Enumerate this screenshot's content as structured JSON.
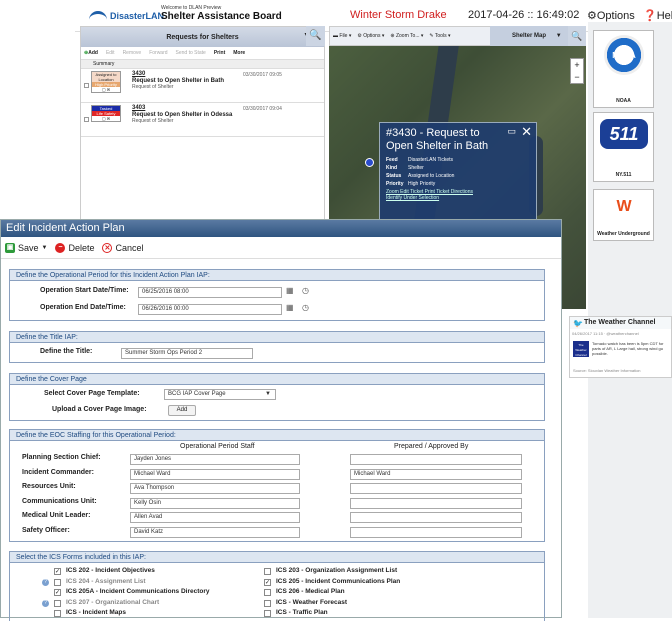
{
  "header": {
    "logo_text": "DisasterLAN",
    "welcome": "Welcome to DLAN Preview",
    "board_title": "Shelter Assistance Board",
    "event_name": "Winter Storm Drake",
    "clock": "2017-04-26 :: 16:49:02",
    "options_label": "Options",
    "help_label": "Help"
  },
  "requests": {
    "title": "Requests for Shelters",
    "tools": {
      "add": "Add",
      "edit": "Edit",
      "remove": "Remove",
      "forward": "Forward",
      "send_to_state": "Send to State",
      "print": "Print",
      "more": "More"
    },
    "summary_header": "Summary",
    "rows": [
      {
        "badge_status": "Assigned to Location",
        "badge_priority": "High Priority",
        "number": "3430",
        "title": "Request to Open Shelter in Bath",
        "subtitle": "Request of Shelter",
        "date": "03/30/2017 09:05"
      },
      {
        "badge_status": "Tasked",
        "badge_priority": "Life Safety",
        "number": "3403",
        "title": "Request to Open Shelter in Odessa",
        "subtitle": "Request of Shelter",
        "date": "03/30/2017 09:04"
      }
    ]
  },
  "map": {
    "toolbar": {
      "file": "File",
      "options": "Options",
      "zoom_to": "Zoom To...",
      "tools": "Tools"
    },
    "title": "Shelter Map",
    "popup": {
      "title": "#3430 - Request to Open Shelter in Bath",
      "feed_label": "Feed",
      "feed": "DisasterLAN Tickets",
      "kind_label": "Kind",
      "kind": "Shelter",
      "status_label": "Status",
      "status": "Assigned to Location",
      "priority_label": "Priority",
      "priority": "High Priority",
      "links": "Zoom  Edit Ticket  Print Ticket  Directions",
      "links2": "Identify Under Selection"
    }
  },
  "sidebar": {
    "noaa_label": "NOAA",
    "ny511_label": "NY.511",
    "wu_label": "Weather Underground",
    "twc": {
      "title": "The Weather Channel",
      "date": "04/26/2017 11:15 · @weatherchannel",
      "logo_text": "The Weather Channel",
      "text": "Tornado watch has been is 5pm CDT for parts of AR, L Large hail, strong wind gu possible.",
      "source": "Source: Siouxlan Weather Information"
    }
  },
  "iap": {
    "title": "Edit Incident Action Plan",
    "save": "Save",
    "delete": "Delete",
    "cancel": "Cancel",
    "period": {
      "header": "Define the Operational Period for this Incident Action Plan IAP:",
      "start_label": "Operation Start Date/Time:",
      "start_value": "06/25/2016 08:00",
      "end_label": "Operation End Date/Time:",
      "end_value": "06/26/2016 00:00"
    },
    "title_section": {
      "header": "Define the Title IAP:",
      "label": "Define the Title:",
      "value": "Summer Storm Ops Period 2"
    },
    "cover": {
      "header": "Define the Cover Page",
      "template_label": "Select Cover Page Template:",
      "template_value": "BCG IAP Cover Page",
      "upload_label": "Upload a Cover Page Image:",
      "add_button": "Add"
    },
    "staffing": {
      "header": "Define the EOC Staffing for this Operational Period:",
      "col_staff": "Operational Period Staff",
      "col_prepared": "Prepared / Approved By",
      "rows": [
        {
          "role": "Planning Section Chief:",
          "staff": "Jayden Jones",
          "prepared": ""
        },
        {
          "role": "Incident Commander:",
          "staff": "Michael Ward",
          "prepared": "Michael Ward"
        },
        {
          "role": "Resources Unit:",
          "staff": "Ava Thompson",
          "prepared": ""
        },
        {
          "role": "Communications Unit:",
          "staff": "Kelly Osin",
          "prepared": ""
        },
        {
          "role": "Medical Unit Leader:",
          "staff": "Allen Avad",
          "prepared": ""
        },
        {
          "role": "Safety Officer:",
          "staff": "David Katz",
          "prepared": ""
        }
      ]
    },
    "forms": {
      "header": "Select the ICS Forms included in this IAP:",
      "left": [
        {
          "label": "ICS 202 - Incident Objectives",
          "checked": true,
          "help": false,
          "disabled": false
        },
        {
          "label": "ICS 204 - Assignment List",
          "checked": false,
          "help": true,
          "disabled": true
        },
        {
          "label": "ICS 205A - Incident Communications Directory",
          "checked": true,
          "help": false,
          "disabled": false
        },
        {
          "label": "ICS 207 - Organizational Chart",
          "checked": false,
          "help": true,
          "disabled": true
        },
        {
          "label": "ICS - Incident Maps",
          "checked": false,
          "help": false,
          "disabled": false
        }
      ],
      "right": [
        {
          "label": "ICS 203 - Organization Assignment List",
          "checked": false
        },
        {
          "label": "ICS 205 - Incident Communications Plan",
          "checked": true
        },
        {
          "label": "ICS 206 - Medical Plan",
          "checked": false
        },
        {
          "label": "ICS - Weather Forecast",
          "checked": false
        },
        {
          "label": "ICS - Traffic Plan",
          "checked": false
        }
      ]
    }
  },
  "colors": {
    "accent": "#2f5480",
    "event": "#d01e1e",
    "section_header": "#dde6f1"
  }
}
